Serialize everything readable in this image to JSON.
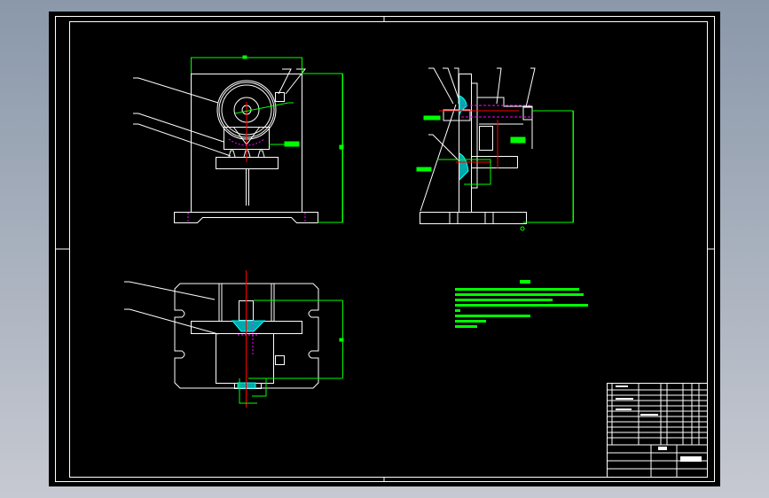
{
  "colors": {
    "background": "#000000",
    "outline": "#ffffff",
    "dimension": "#00ff00",
    "centerline": "#ff0000",
    "hidden": "#ff00ff",
    "hatch": "#00ffff"
  },
  "views": [
    "front-view",
    "side-view",
    "top-view",
    "technical-requirements",
    "title-block"
  ]
}
